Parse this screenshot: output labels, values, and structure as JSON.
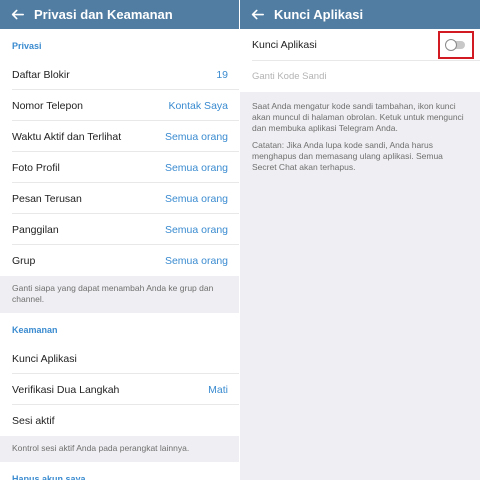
{
  "left_panel": {
    "title": "Privasi dan Keamanan",
    "privacy_header": "Privasi",
    "privacy_items": [
      {
        "label": "Daftar Blokir",
        "value": "19"
      },
      {
        "label": "Nomor Telepon",
        "value": "Kontak Saya"
      },
      {
        "label": "Waktu Aktif dan Terlihat",
        "value": "Semua orang"
      },
      {
        "label": "Foto Profil",
        "value": "Semua orang"
      },
      {
        "label": "Pesan Terusan",
        "value": "Semua orang"
      },
      {
        "label": "Panggilan",
        "value": "Semua orang"
      },
      {
        "label": "Grup",
        "value": "Semua orang"
      }
    ],
    "privacy_note": "Ganti siapa yang dapat menambah Anda ke grup dan channel.",
    "security_header": "Keamanan",
    "security_items": [
      {
        "label": "Kunci Aplikasi",
        "value": ""
      },
      {
        "label": "Verifikasi Dua Langkah",
        "value": "Mati"
      },
      {
        "label": "Sesi aktif",
        "value": ""
      }
    ],
    "security_note": "Kontrol sesi aktif Anda pada perangkat lainnya.",
    "delete_header": "Hapus akun saya"
  },
  "right_panel": {
    "title": "Kunci Aplikasi",
    "passcode_lock_label": "Kunci Aplikasi",
    "passcode_lock_enabled": false,
    "change_passcode_label": "Ganti Kode Sandi",
    "info_text": "Saat Anda mengatur kode sandi tambahan, ikon kunci akan muncul di halaman obrolan. Ketuk untuk mengunci dan membuka aplikasi Telegram Anda.",
    "note_text": "Catatan: Jika Anda lupa kode sandi, Anda harus menghapus dan memasang ulang aplikasi. Semua Secret Chat akan terhapus."
  },
  "colors": {
    "header_bar": "#517da2",
    "accent": "#3a8bd0",
    "highlight_box": "#d21a23"
  }
}
